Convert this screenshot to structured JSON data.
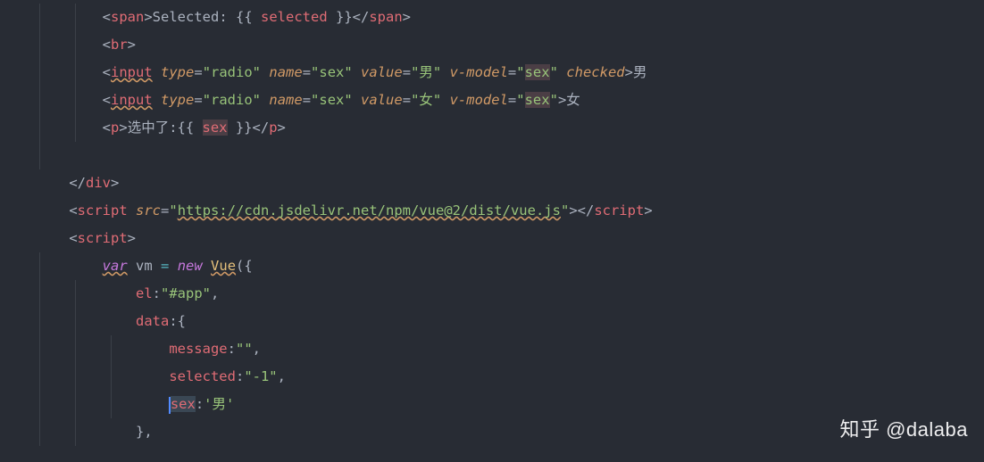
{
  "code": {
    "line1": {
      "tag_open": "span",
      "text_prefix": "Selected: {{ ",
      "mustache_var": "selected",
      "text_suffix": " }}",
      "tag_close": "span"
    },
    "line2": {
      "tag": "br"
    },
    "line3": {
      "tag": "input",
      "attrs": {
        "type_k": "type",
        "type_v": "\"radio\"",
        "name_k": "name",
        "name_v": "\"sex\"",
        "value_k": "value",
        "value_v": "\"男\"",
        "vmodel_k": "v-model",
        "vmodel_v_open": "\"",
        "vmodel_v_hl": "sex",
        "vmodel_v_close": "\"",
        "checked": "checked"
      },
      "trailing": "男"
    },
    "line4": {
      "tag": "input",
      "attrs": {
        "type_k": "type",
        "type_v": "\"radio\"",
        "name_k": "name",
        "name_v": "\"sex\"",
        "value_k": "value",
        "value_v": "\"女\"",
        "vmodel_k": "v-model",
        "vmodel_v_open": "\"",
        "vmodel_v_hl": "sex",
        "vmodel_v_close": "\""
      },
      "trailing": "女"
    },
    "line5": {
      "tag_open": "p",
      "text_prefix": "选中了:{{ ",
      "mustache_var": "sex",
      "text_suffix": " }}",
      "tag_close": "p"
    },
    "line7": {
      "tag_close": "div"
    },
    "line8": {
      "tag": "script",
      "src_k": "src",
      "src_v_open": "\"",
      "src_url": "https://cdn.jsdelivr.net/npm/vue@2/dist/vue.js",
      "src_v_close": "\"",
      "tag_close": "script"
    },
    "line9": {
      "tag": "script"
    },
    "line10": {
      "kw_var": "var",
      "name": "vm",
      "eq": "=",
      "kw_new": "new",
      "cls": "Vue",
      "paren": "({"
    },
    "line11": {
      "prop": "el",
      "colon": ":",
      "val": "\"#app\"",
      "comma": ","
    },
    "line12": {
      "prop": "data",
      "colon": ":",
      "brace": "{"
    },
    "line13": {
      "prop": "message",
      "colon": ":",
      "val": "\"\"",
      "comma": ","
    },
    "line14": {
      "prop": "selected",
      "colon": ":",
      "val": "\"-1\"",
      "comma": ","
    },
    "line15": {
      "prop": "sex",
      "colon": ":",
      "val": "'男'"
    },
    "line16": {
      "brace": "}",
      "comma": ","
    }
  },
  "watermark": "知乎 @dalaba"
}
